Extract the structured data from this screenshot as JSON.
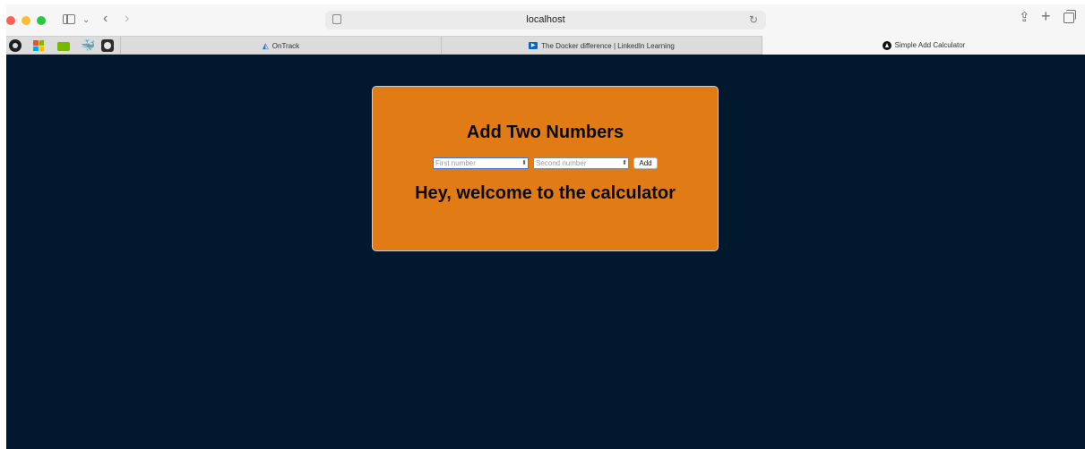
{
  "browser": {
    "address": "localhost",
    "tabs": [
      {
        "label": "OnTrack"
      },
      {
        "label": "The Docker difference | LinkedIn Learning"
      },
      {
        "label": "Simple Add Calculator",
        "active": true
      }
    ],
    "favorites": [
      "github-icon",
      "microsoft-icon",
      "nvidia-icon",
      "docker-icon",
      "github-alt-icon"
    ]
  },
  "page": {
    "background": "#02182e",
    "card_color": "#e07b16",
    "title": "Add Two Numbers",
    "first_input": {
      "placeholder": "First number",
      "value": ""
    },
    "second_input": {
      "placeholder": "Second number",
      "value": ""
    },
    "add_label": "Add",
    "message": "Hey, welcome to the calculator"
  }
}
